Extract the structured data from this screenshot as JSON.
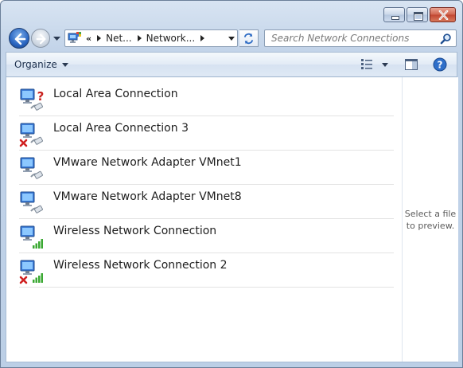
{
  "address": {
    "overflow_glyph": "«",
    "crumbs": [
      "Net...",
      "Network..."
    ]
  },
  "search": {
    "placeholder": "Search Network Connections"
  },
  "toolbar": {
    "organize_label": "Organize"
  },
  "connections": [
    {
      "name": "Local Area Connection",
      "adapter": "wired",
      "status": "unknown"
    },
    {
      "name": "Local Area Connection 3",
      "adapter": "wired",
      "status": "disconnected"
    },
    {
      "name": "VMware Network Adapter VMnet1",
      "adapter": "wired",
      "status": "ok"
    },
    {
      "name": "VMware Network Adapter VMnet8",
      "adapter": "wired",
      "status": "ok"
    },
    {
      "name": "Wireless Network Connection",
      "adapter": "wireless",
      "status": "ok"
    },
    {
      "name": "Wireless Network Connection 2",
      "adapter": "wireless",
      "status": "disconnected"
    }
  ],
  "preview_pane": {
    "line1": "Select a file",
    "line2": "to preview."
  },
  "icons": {
    "back": "back-arrow-icon",
    "forward": "forward-arrow-icon",
    "refresh": "refresh-icon",
    "search": "magnifier-icon",
    "views": "details-view-icon",
    "preview": "preview-pane-icon",
    "help": "help-icon"
  },
  "colors": {
    "accent": "#2a66c2",
    "error_x": "#d01f1f",
    "help_blue": "#2f6fc9",
    "signal_green": "#3aa832"
  }
}
